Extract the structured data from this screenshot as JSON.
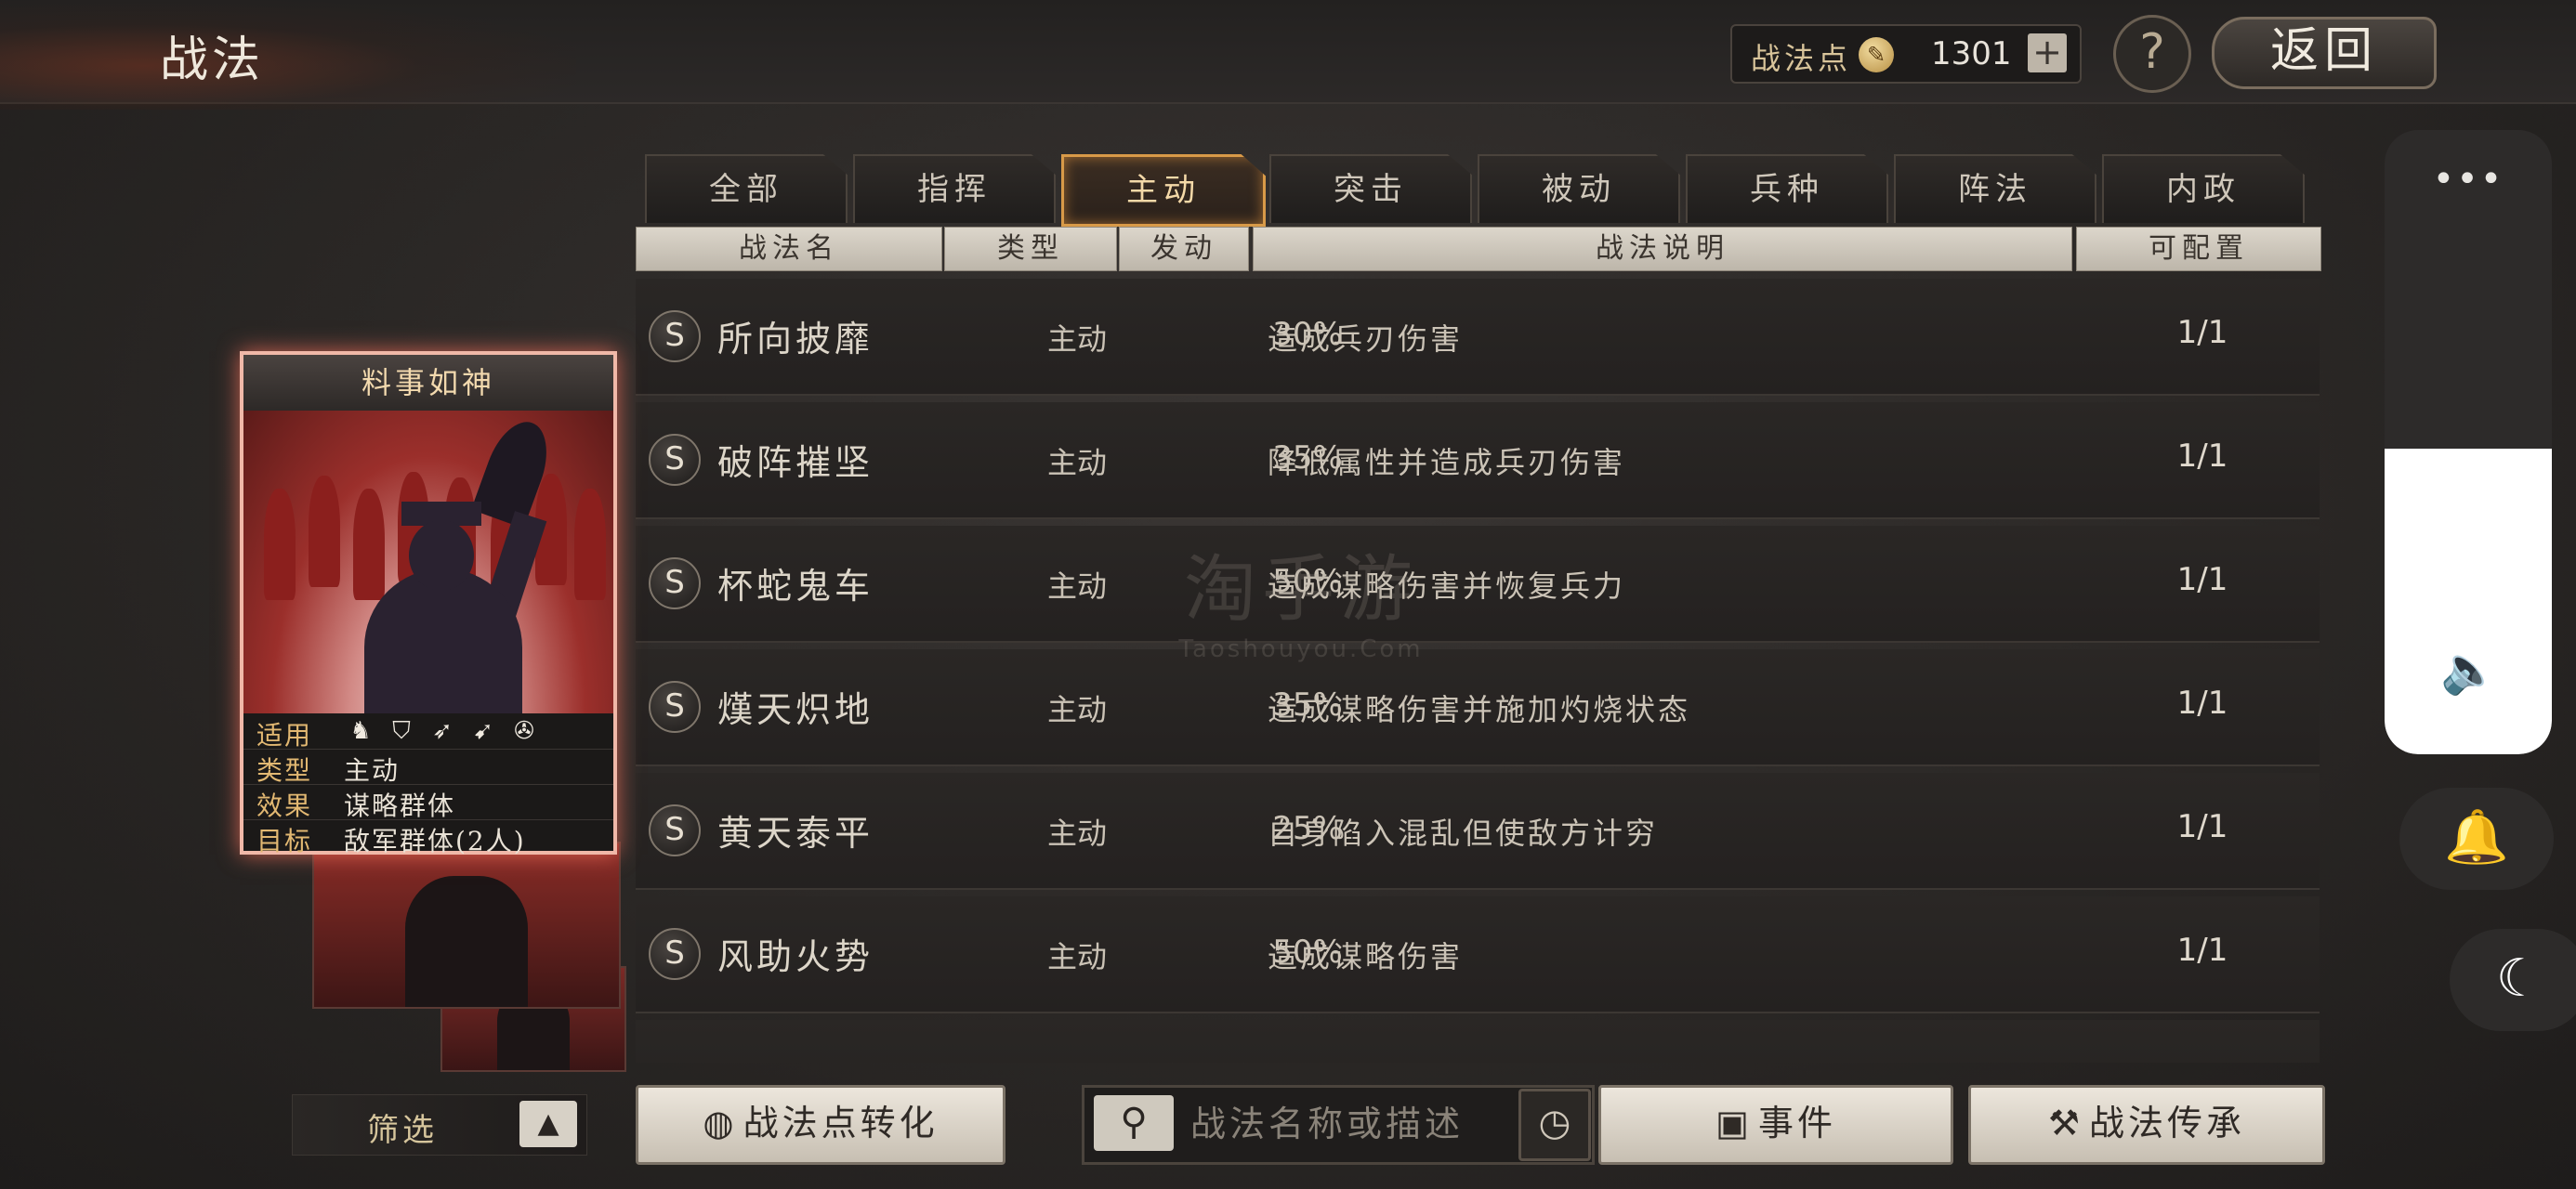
{
  "header": {
    "title": "战法",
    "points_label": "战法点",
    "points_value": "1301",
    "add_label": "+",
    "help_label": "?",
    "back_label": "返回"
  },
  "tabs": [
    {
      "label": "全部",
      "active": false
    },
    {
      "label": "指挥",
      "active": false
    },
    {
      "label": "主动",
      "active": true
    },
    {
      "label": "突击",
      "active": false
    },
    {
      "label": "被动",
      "active": false
    },
    {
      "label": "兵种",
      "active": false
    },
    {
      "label": "阵法",
      "active": false
    },
    {
      "label": "内政",
      "active": false
    }
  ],
  "columns": {
    "name": "战法名",
    "type": "类型",
    "rate": "发动",
    "desc": "战法说明",
    "config": "可配置"
  },
  "rows": [
    {
      "grade": "S",
      "name": "所向披靡",
      "type": "主动",
      "rate": "30%",
      "desc": "造成兵刃伤害",
      "config": "1/1"
    },
    {
      "grade": "S",
      "name": "破阵摧坚",
      "type": "主动",
      "rate": "35%",
      "desc": "降低属性并造成兵刃伤害",
      "config": "1/1"
    },
    {
      "grade": "S",
      "name": "杯蛇鬼车",
      "type": "主动",
      "rate": "50%",
      "desc": "造成谋略伤害并恢复兵力",
      "config": "1/1"
    },
    {
      "grade": "S",
      "name": "熯天炽地",
      "type": "主动",
      "rate": "35%",
      "desc": "造成谋略伤害并施加灼烧状态",
      "config": "1/1"
    },
    {
      "grade": "S",
      "name": "黄天泰平",
      "type": "主动",
      "rate": "25%",
      "desc": "自身陷入混乱但使敌方计穷",
      "config": "1/1"
    },
    {
      "grade": "S",
      "name": "风助火势",
      "type": "主动",
      "rate": "50%",
      "desc": "造成谋略伤害",
      "config": "1/1"
    }
  ],
  "watermark": {
    "cn": "淘手游",
    "en": "Taoshouyou.Com"
  },
  "card": {
    "title": "料事如神",
    "rows": {
      "apply_key": "适用",
      "type_key": "类型",
      "type_val": "主动",
      "effect_key": "效果",
      "effect_val": "谋略群体",
      "target_key": "目标",
      "target_val": "敌军群体(2人)"
    },
    "troop_icons": [
      "cavalry-icon",
      "shield-icon",
      "bow-icon",
      "spear-icon",
      "wheel-icon"
    ]
  },
  "bottom": {
    "filter_label": "筛选",
    "filter_toggle": "▲",
    "convert_label": "战法点转化",
    "search_placeholder": "战法名称或描述",
    "event_label": "事件",
    "inherit_label": "战法传承"
  },
  "overlay": {
    "more_label": "•••",
    "volume_level": 0.49
  }
}
